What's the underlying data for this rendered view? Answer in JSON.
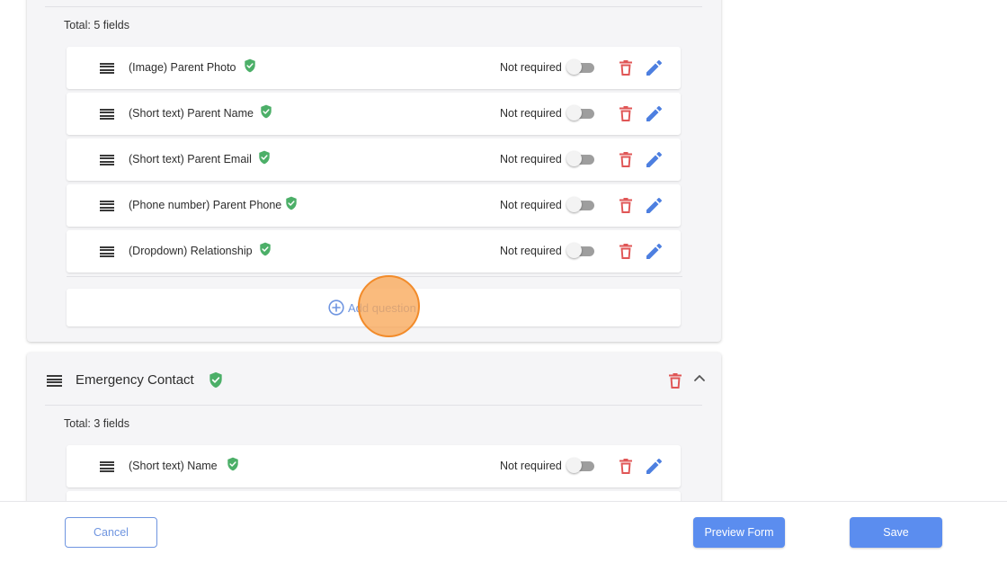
{
  "colors": {
    "accent": "#5b8def",
    "shield_green": "#4caf68",
    "trash_red": "#e05656",
    "edit_blue": "#4d7fe0",
    "toggle_off": "#9e9e9e",
    "click_highlight": "#f28b2a"
  },
  "parent_section": {
    "total_label": "Total: 5 fields",
    "fields": [
      {
        "label": "(Image) Parent Photo",
        "required_label": "Not required",
        "required": false
      },
      {
        "label": "(Short text) Parent Name",
        "required_label": "Not required",
        "required": false
      },
      {
        "label": "(Short text) Parent Email",
        "required_label": "Not required",
        "required": false
      },
      {
        "label": "(Phone number) Parent Phone",
        "required_label": "Not required",
        "required": false
      },
      {
        "label": "(Dropdown) Relationship",
        "required_label": "Not required",
        "required": false
      }
    ],
    "add_question_label": "Add question"
  },
  "emergency_section": {
    "title": "Emergency Contact",
    "total_label": "Total: 3 fields",
    "fields": [
      {
        "label": "(Short text) Name",
        "required_label": "Not required",
        "required": false
      }
    ]
  },
  "footer": {
    "cancel_label": "Cancel",
    "preview_label": "Preview Form",
    "save_label": "Save"
  },
  "icons": {
    "drag": "drag-handle-icon",
    "shield": "shield-check-icon",
    "trash": "trash-icon",
    "edit": "pencil-icon",
    "add": "plus-circle-icon",
    "collapse": "chevron-up-icon"
  }
}
